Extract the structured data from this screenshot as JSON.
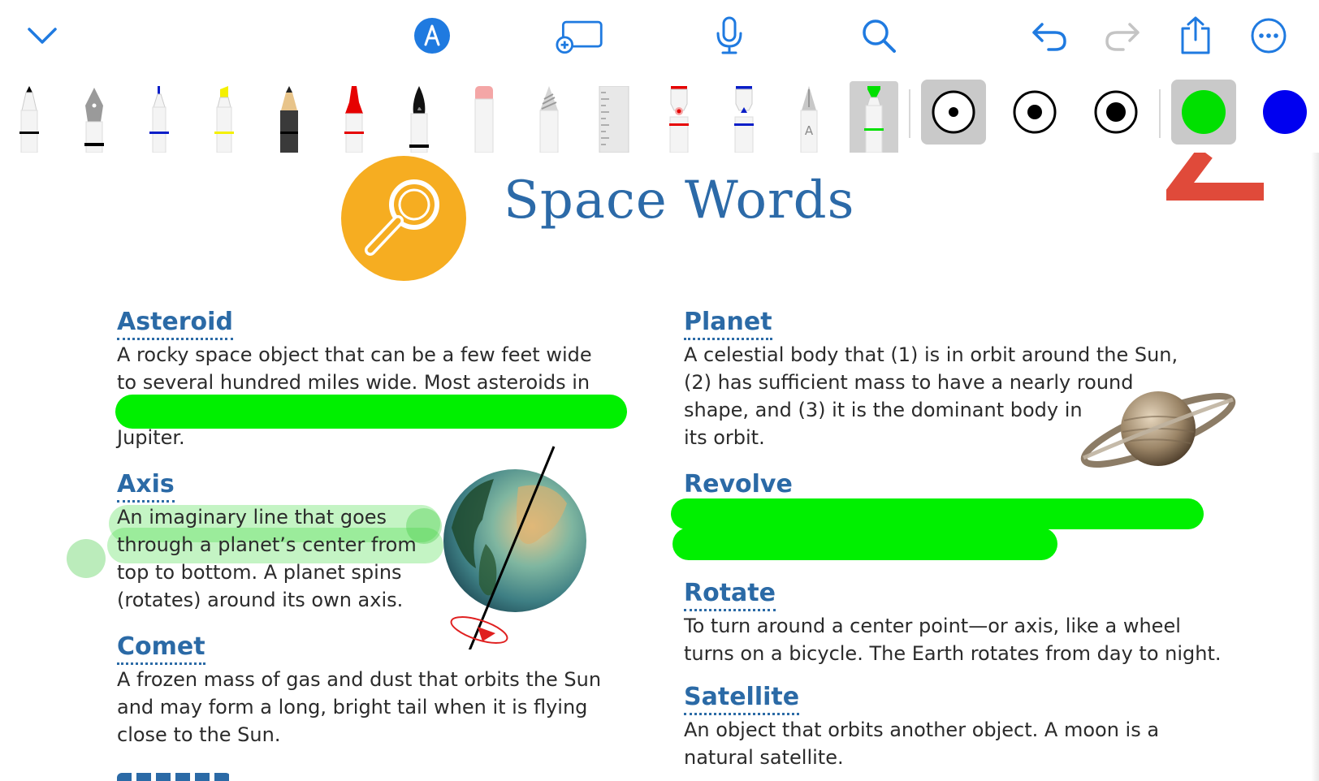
{
  "toolbar": {
    "buttons": [
      {
        "name": "collapse-chevron",
        "icon": "chevron-down-icon"
      },
      {
        "name": "markup",
        "icon": "markup-pen-circle-icon"
      },
      {
        "name": "add-page",
        "icon": "add-page-icon"
      },
      {
        "name": "microphone",
        "icon": "microphone-icon"
      },
      {
        "name": "search",
        "icon": "magnifier-icon"
      },
      {
        "name": "undo",
        "icon": "undo-arrow-icon"
      },
      {
        "name": "redo",
        "icon": "redo-arrow-icon"
      },
      {
        "name": "share",
        "icon": "share-icon"
      },
      {
        "name": "more",
        "icon": "ellipsis-circle-icon"
      }
    ],
    "accent_color": "#1f7ae0"
  },
  "tools": {
    "items": [
      {
        "name": "fine-pen",
        "color": "#000000"
      },
      {
        "name": "fountain-pen",
        "color": "#000000"
      },
      {
        "name": "ballpoint-pen",
        "color": "#0a1ec8"
      },
      {
        "name": "highlighter",
        "color": "#f4f000"
      },
      {
        "name": "pencil",
        "color": "#2a2a2a"
      },
      {
        "name": "crayon",
        "color": "#e60000"
      },
      {
        "name": "brush-pen",
        "color": "#000000"
      },
      {
        "name": "eraser",
        "color": "#f4a6a6"
      },
      {
        "name": "lasso",
        "color": "#bdbdbd"
      },
      {
        "name": "ruler",
        "color": "#e6e6e6"
      },
      {
        "name": "shape-tool",
        "color": "#e60000"
      },
      {
        "name": "fill-tool",
        "color": "#0a1ec8"
      },
      {
        "name": "text-tool",
        "color": "#8a8a8a",
        "letter": "A"
      },
      {
        "name": "active-highlighter",
        "color": "#00e000",
        "selected": true
      }
    ],
    "sizes": [
      "small",
      "medium",
      "large"
    ],
    "selected_size": "small",
    "colors": [
      {
        "name": "green",
        "value": "#00e000",
        "selected": true
      },
      {
        "name": "blue",
        "value": "#0000f0",
        "selected": false
      }
    ]
  },
  "document": {
    "title": "Space Words",
    "entries": {
      "asteroid": {
        "term": "Asteroid",
        "lines": [
          "A rocky space object that can be a few feet wide",
          "to several hundred miles wide. Most asteroids in",
          "Jupiter."
        ]
      },
      "axis": {
        "term": "Axis",
        "lines": [
          "An imaginary line that goes",
          "through a planet’s center from",
          "top to bottom. A planet spins",
          "(rotates) around its own axis."
        ]
      },
      "comet": {
        "term": "Comet",
        "lines": [
          "A frozen mass of gas and dust that orbits the Sun",
          "and may form a long, bright tail when it is flying",
          "close to the Sun."
        ]
      },
      "planet": {
        "term": "Planet",
        "lines": [
          "A celestial body that (1) is in orbit around the Sun,",
          "(2) has sufficient mass to have a nearly round",
          "shape, and (3) it is the dominant body in",
          "its orbit."
        ]
      },
      "revolve": {
        "term": "Revolve",
        "lines": []
      },
      "rotate": {
        "term": "Rotate",
        "lines": [
          "To turn around a center point—or axis, like a wheel",
          "turns on a bicycle. The Earth rotates from day to night."
        ]
      },
      "satellite": {
        "term": "Satellite",
        "lines": [
          "An object that orbits another object. A moon is a",
          "natural satellite."
        ]
      }
    },
    "highlight_color": "#00f000",
    "annotation_color": "#e04a3a"
  }
}
